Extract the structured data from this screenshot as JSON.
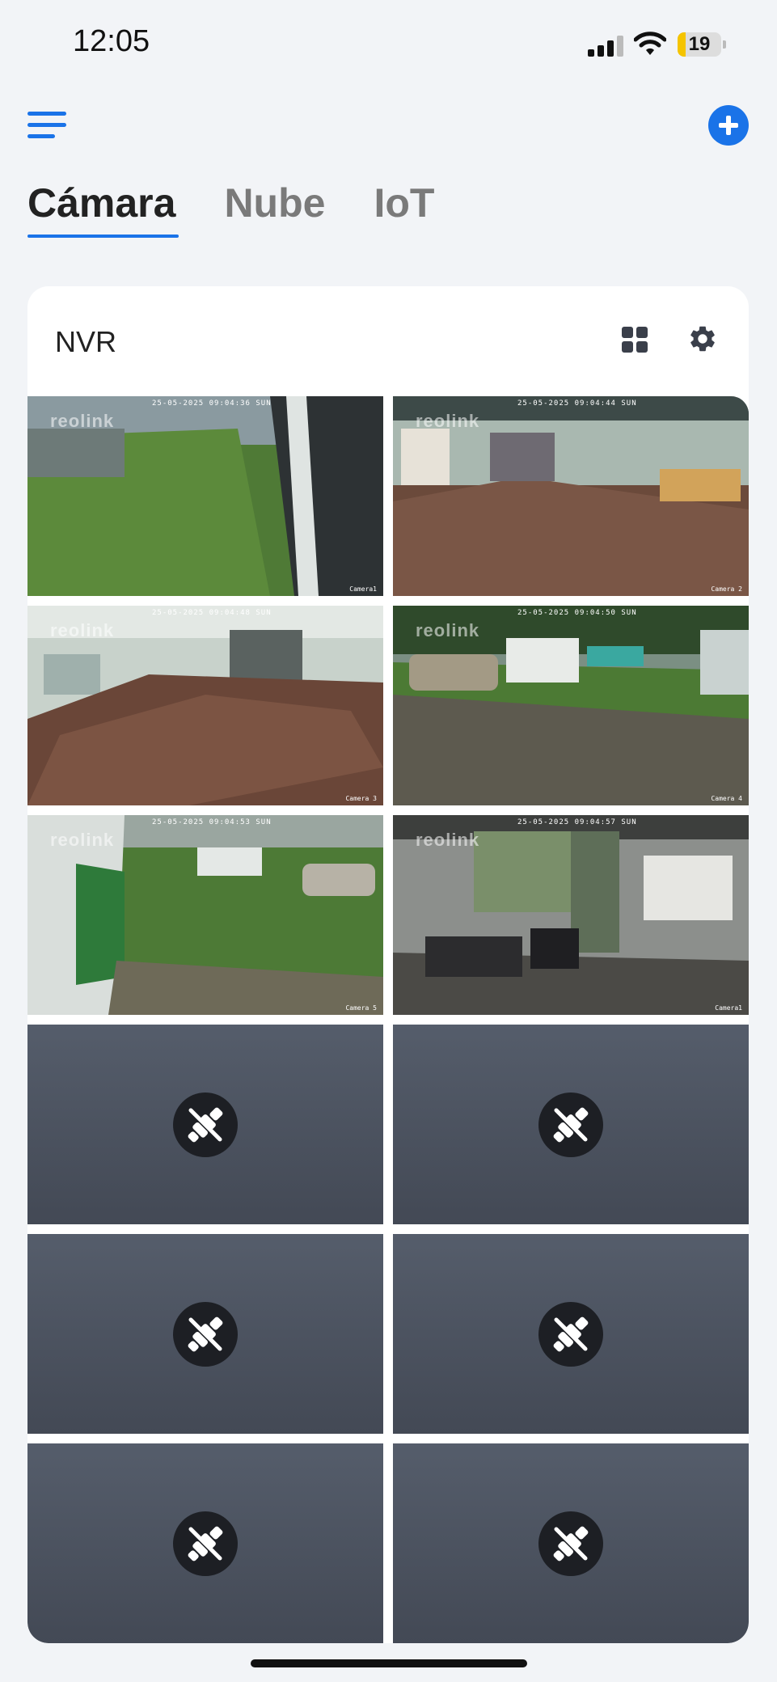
{
  "status_bar": {
    "time": "12:05",
    "battery": "19",
    "battery_level": 0.19
  },
  "tabs": [
    {
      "label": "Cámara",
      "active": true
    },
    {
      "label": "Nube",
      "active": false
    },
    {
      "label": "IoT",
      "active": false
    }
  ],
  "device": {
    "name": "NVR"
  },
  "colors": {
    "accent": "#1a73e8",
    "background": "#f2f4f7",
    "offline_tile": "#4b525e"
  },
  "channels": [
    {
      "status": "live",
      "timestamp": "25-05-2025 09:04:36 SUN",
      "label": "Camera1",
      "logo": "reolink",
      "scene": "grass-yard"
    },
    {
      "status": "live",
      "timestamp": "25-05-2025 09:04:44 SUN",
      "label": "Camera 2",
      "logo": "reolink",
      "scene": "warehouse"
    },
    {
      "status": "live",
      "timestamp": "25-05-2025 09:04:48 SUN",
      "label": "Camera 3",
      "logo": "reolink",
      "scene": "storage-room"
    },
    {
      "status": "live",
      "timestamp": "25-05-2025 09:04:50 SUN",
      "label": "Camera 4",
      "logo": "reolink",
      "scene": "parking"
    },
    {
      "status": "live",
      "timestamp": "25-05-2025 09:04:53 SUN",
      "label": "Camera 5",
      "logo": "reolink",
      "scene": "building-side"
    },
    {
      "status": "live",
      "timestamp": "25-05-2025 09:04:57 SUN",
      "label": "Camera1",
      "logo": "reolink",
      "scene": "office"
    },
    {
      "status": "offline",
      "icon": "disconnected-plug-icon"
    },
    {
      "status": "offline",
      "icon": "disconnected-plug-icon"
    },
    {
      "status": "offline",
      "icon": "disconnected-plug-icon"
    },
    {
      "status": "offline",
      "icon": "disconnected-plug-icon"
    },
    {
      "status": "offline",
      "icon": "disconnected-plug-icon"
    },
    {
      "status": "offline",
      "icon": "disconnected-plug-icon"
    }
  ]
}
